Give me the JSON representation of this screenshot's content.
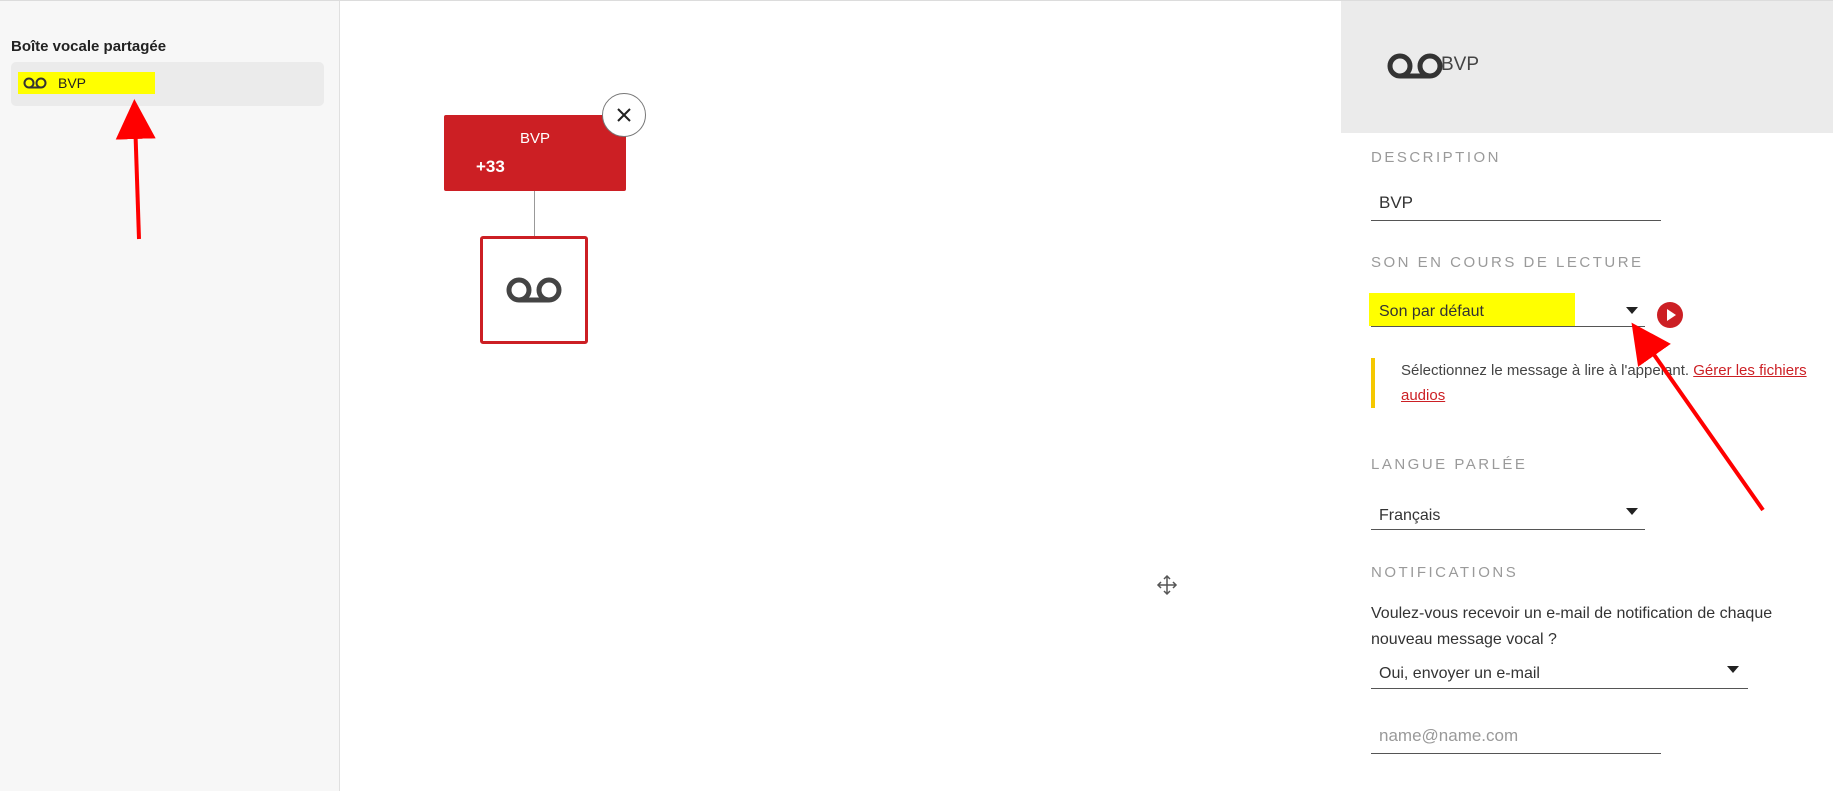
{
  "sidebar": {
    "title": "Boîte vocale partagée",
    "items": [
      {
        "label": "BVP",
        "icon": "voicemail-icon"
      }
    ]
  },
  "canvas": {
    "main_node": {
      "title": "BVP",
      "number": "+33"
    },
    "voicemail_node": {
      "icon": "voicemail-icon"
    }
  },
  "panel": {
    "header": {
      "name": "BVP",
      "icon": "voicemail-icon"
    },
    "description": {
      "label": "DESCRIPTION",
      "value": "BVP"
    },
    "sound": {
      "label": "SON EN COURS DE LECTURE",
      "selected": "Son par défaut",
      "hint_text": "Sélectionnez le message à lire à l'appelant. ",
      "hint_link": "Gérer les fichiers audios"
    },
    "language": {
      "label": "LANGUE PARLÉE",
      "selected": "Français"
    },
    "notifications": {
      "label": "NOTIFICATIONS",
      "question": "Voulez-vous recevoir un e-mail de notification de chaque nouveau message vocal ?",
      "selected": "Oui, envoyer un e-mail",
      "email_placeholder": "name@name.com"
    }
  },
  "colors": {
    "brand_red": "#cc1f24",
    "highlight_yellow": "#ffff00",
    "hint_border": "#f5c800",
    "annotation_arrow": "#ff0000"
  }
}
